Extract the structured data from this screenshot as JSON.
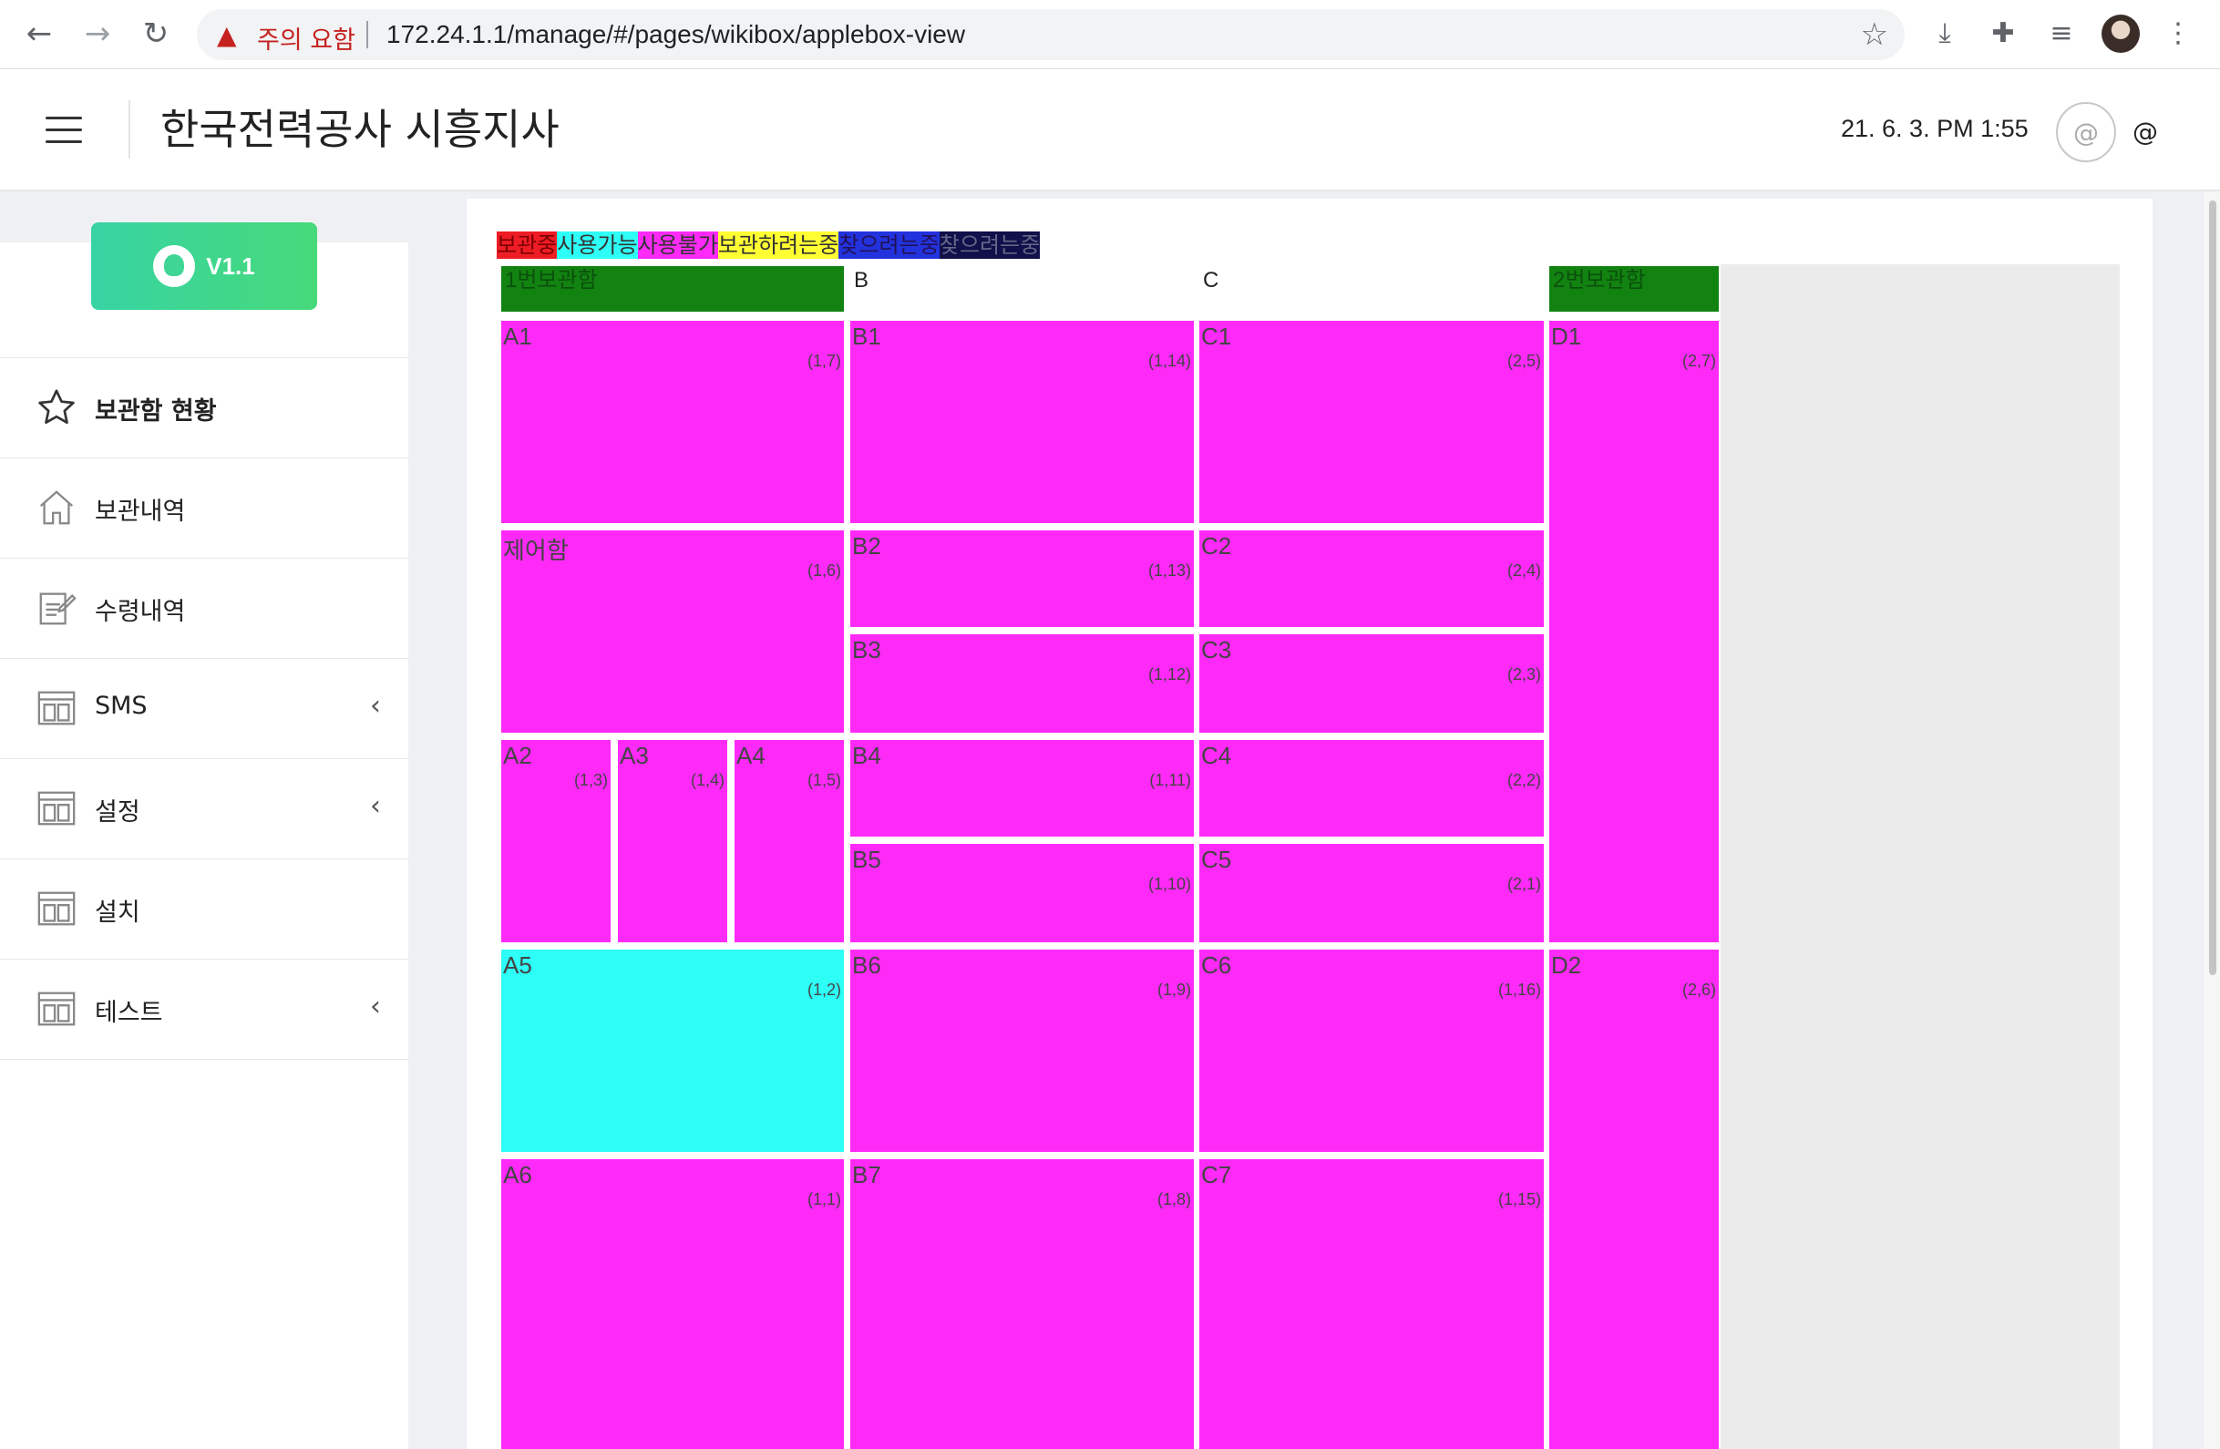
{
  "browser": {
    "warning_text": "주의 요함",
    "url": "172.24.1.1/manage/#/pages/wikibox/applebox-view",
    "icons": [
      "back-icon",
      "forward-icon",
      "reload-icon",
      "warning-icon",
      "bookmark-star-icon",
      "download-icon",
      "extensions-icon",
      "media-icon",
      "profile-avatar",
      "more-icon"
    ]
  },
  "header": {
    "title": "한국전력공사 시흥지사",
    "datetime": "21. 6. 3. PM 1:55",
    "avatar_text": "@",
    "user_text": "@"
  },
  "sidebar": {
    "version_label": "V1.1",
    "items": [
      {
        "label": "보관함 현황",
        "icon": "star-icon",
        "active": true,
        "chevron": false
      },
      {
        "label": "보관내역",
        "icon": "home-icon",
        "active": false,
        "chevron": false
      },
      {
        "label": "수령내역",
        "icon": "edit-icon",
        "active": false,
        "chevron": false
      },
      {
        "label": "SMS",
        "icon": "layout-icon",
        "active": false,
        "chevron": true
      },
      {
        "label": "설정",
        "icon": "layout-icon",
        "active": false,
        "chevron": true
      },
      {
        "label": "설치",
        "icon": "layout-icon",
        "active": false,
        "chevron": false
      },
      {
        "label": "테스트",
        "icon": "layout-icon",
        "active": false,
        "chevron": true
      }
    ]
  },
  "legend": [
    {
      "label": "보관중",
      "bg": "#ee1c24",
      "fg": "#7a0000"
    },
    {
      "label": "사용가능",
      "bg": "#2dfff7",
      "fg": "#333333"
    },
    {
      "label": "사용불가",
      "bg": "#ff2af8",
      "fg": "#333333"
    },
    {
      "label": "보관하려는중",
      "bg": "#ffff33",
      "fg": "#333333"
    },
    {
      "label": "찾으려는중",
      "bg": "#2233dd",
      "fg": "#22115a"
    },
    {
      "label": "찾으려는중",
      "bg": "#10104a",
      "fg": "#666688"
    }
  ],
  "columns": [
    {
      "label": "1번보관함",
      "bg": "#128211",
      "fg": "#0c500c"
    },
    {
      "label": "B",
      "bg": "#ffffff",
      "fg": "#222222"
    },
    {
      "label": "C",
      "bg": "#ffffff",
      "fg": "#222222"
    },
    {
      "label": "2번보관함",
      "bg": "#128211",
      "fg": "#0c500c"
    }
  ],
  "colors": {
    "unavailable": "#ff2af8",
    "available": "#2dfff7"
  },
  "lockers": [
    {
      "name": "A1",
      "pos": "(1,7)",
      "status": "unavailable"
    },
    {
      "name": "제어함",
      "pos": "(1,6)",
      "status": "unavailable"
    },
    {
      "name": "A2",
      "pos": "(1,3)",
      "status": "unavailable"
    },
    {
      "name": "A3",
      "pos": "(1,4)",
      "status": "unavailable"
    },
    {
      "name": "A4",
      "pos": "(1,5)",
      "status": "unavailable"
    },
    {
      "name": "A5",
      "pos": "(1,2)",
      "status": "available"
    },
    {
      "name": "A6",
      "pos": "(1,1)",
      "status": "unavailable"
    },
    {
      "name": "B1",
      "pos": "(1,14)",
      "status": "unavailable"
    },
    {
      "name": "B2",
      "pos": "(1,13)",
      "status": "unavailable"
    },
    {
      "name": "B3",
      "pos": "(1,12)",
      "status": "unavailable"
    },
    {
      "name": "B4",
      "pos": "(1,11)",
      "status": "unavailable"
    },
    {
      "name": "B5",
      "pos": "(1,10)",
      "status": "unavailable"
    },
    {
      "name": "B6",
      "pos": "(1,9)",
      "status": "unavailable"
    },
    {
      "name": "B7",
      "pos": "(1,8)",
      "status": "unavailable"
    },
    {
      "name": "C1",
      "pos": "(2,5)",
      "status": "unavailable"
    },
    {
      "name": "C2",
      "pos": "(2,4)",
      "status": "unavailable"
    },
    {
      "name": "C3",
      "pos": "(2,3)",
      "status": "unavailable"
    },
    {
      "name": "C4",
      "pos": "(2,2)",
      "status": "unavailable"
    },
    {
      "name": "C5",
      "pos": "(2,1)",
      "status": "unavailable"
    },
    {
      "name": "C6",
      "pos": "(1,16)",
      "status": "unavailable"
    },
    {
      "name": "C7",
      "pos": "(1,15)",
      "status": "unavailable"
    },
    {
      "name": "D1",
      "pos": "(2,7)",
      "status": "unavailable"
    },
    {
      "name": "D2",
      "pos": "(2,6)",
      "status": "unavailable"
    }
  ]
}
